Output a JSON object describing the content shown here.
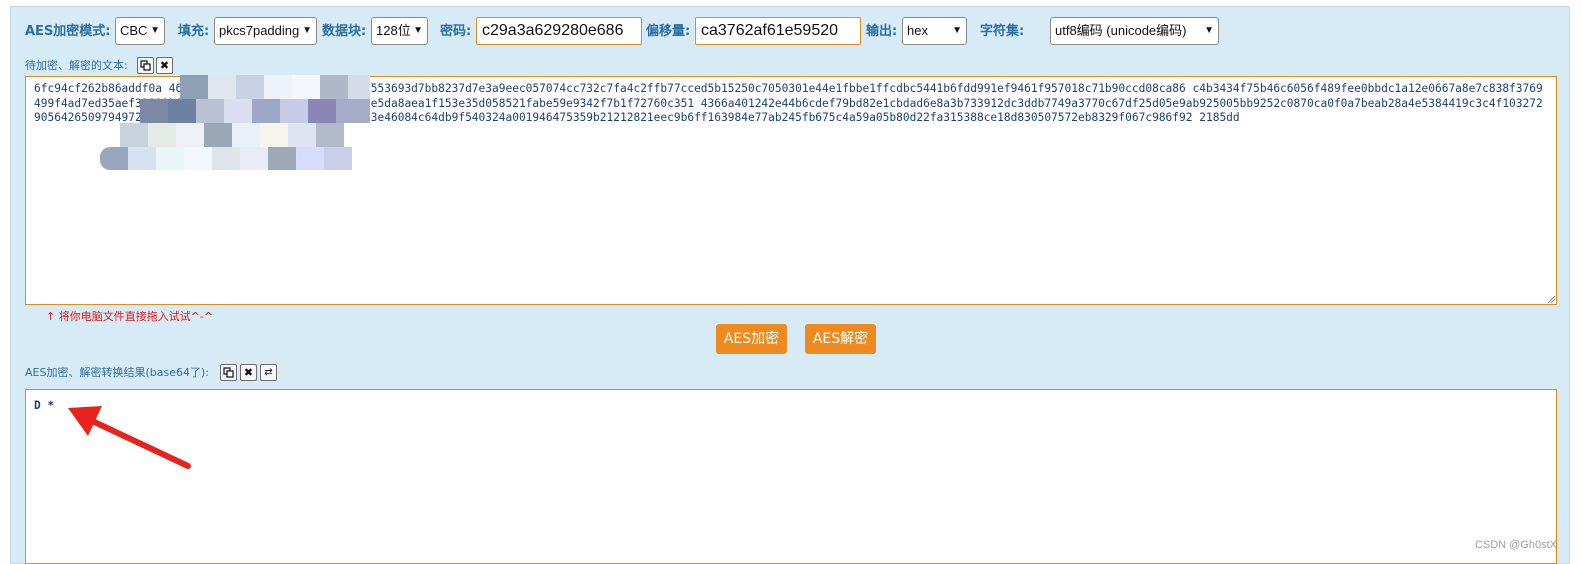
{
  "toolbar": {
    "mode_label": "AES加密模式:",
    "mode_value": "CBC",
    "padding_label": "填充:",
    "padding_value": "pkcs7padding",
    "block_label": "数据块:",
    "block_value": "128位",
    "key_label": "密码:",
    "key_value": "c29a3a629280e686",
    "iv_label": "偏移量:",
    "iv_value": "ca3762af61e59520",
    "output_label": "输出:",
    "output_value": "hex",
    "charset_label": "字符集:",
    "charset_value": "utf8编码 (unicode编码)"
  },
  "input_section": {
    "label": "待加密、解密的文本:",
    "copy_icon": "copy-icon",
    "clear_icon": "close-icon",
    "text": "6fc94cf262b86addf0a                                     460a63c8c72e60df891eb19edafee2553693d7bb8237d7e3a9eec057074cc732c7fa4c2ffb77cced5b15250c7050301e44e1fbbe1ffcdbc5441b6fdd991ef9461f957018c71b90ccd08ca86                                      c4b3434f75b46c6056f489fee0bbdc1a12e0667a8e7c838f3769499f4ad7ed35aef32339b688a240d47ab060ad377a93336132e5da8aea1f153e35d058521fabe59e9342f7b1f72760c351                                      4366a401242e44b6cdef79bd82e1cbdad6e8a3b733912dc3ddb7749a3770c67df25d05e9ab925005bb9252c0870ca0f0a7beab28a4e5384419c3c4f1032729056426509794972a31a1b1                                      990f308b5eb254dbd19b6637c93e46084c64db9f540324a001946475359b21212821eec9b6ff163984e77ab245fb675c4a59a05b80d22fa315388ce18d830507572eb8329f067c986f92                                      2185dd",
    "hint": "↑ 将你电脑文件直接拖入试试^-^"
  },
  "buttons": {
    "encrypt": "AES加密",
    "decrypt": "AES解密"
  },
  "output_section": {
    "label": "AES加密、解密转换结果(base64了):",
    "copy_icon": "copy-icon",
    "clear_icon": "close-icon",
    "swap_icon": "swap-icon",
    "text": "D *"
  },
  "watermark": "CSDN @Gh0stX",
  "colors": {
    "panel_bg": "#d7ebf6",
    "label": "#2d6ea5",
    "accent_orange": "#ee8a1e",
    "hint_red": "#e01919",
    "arrow_red": "#e8231d"
  }
}
